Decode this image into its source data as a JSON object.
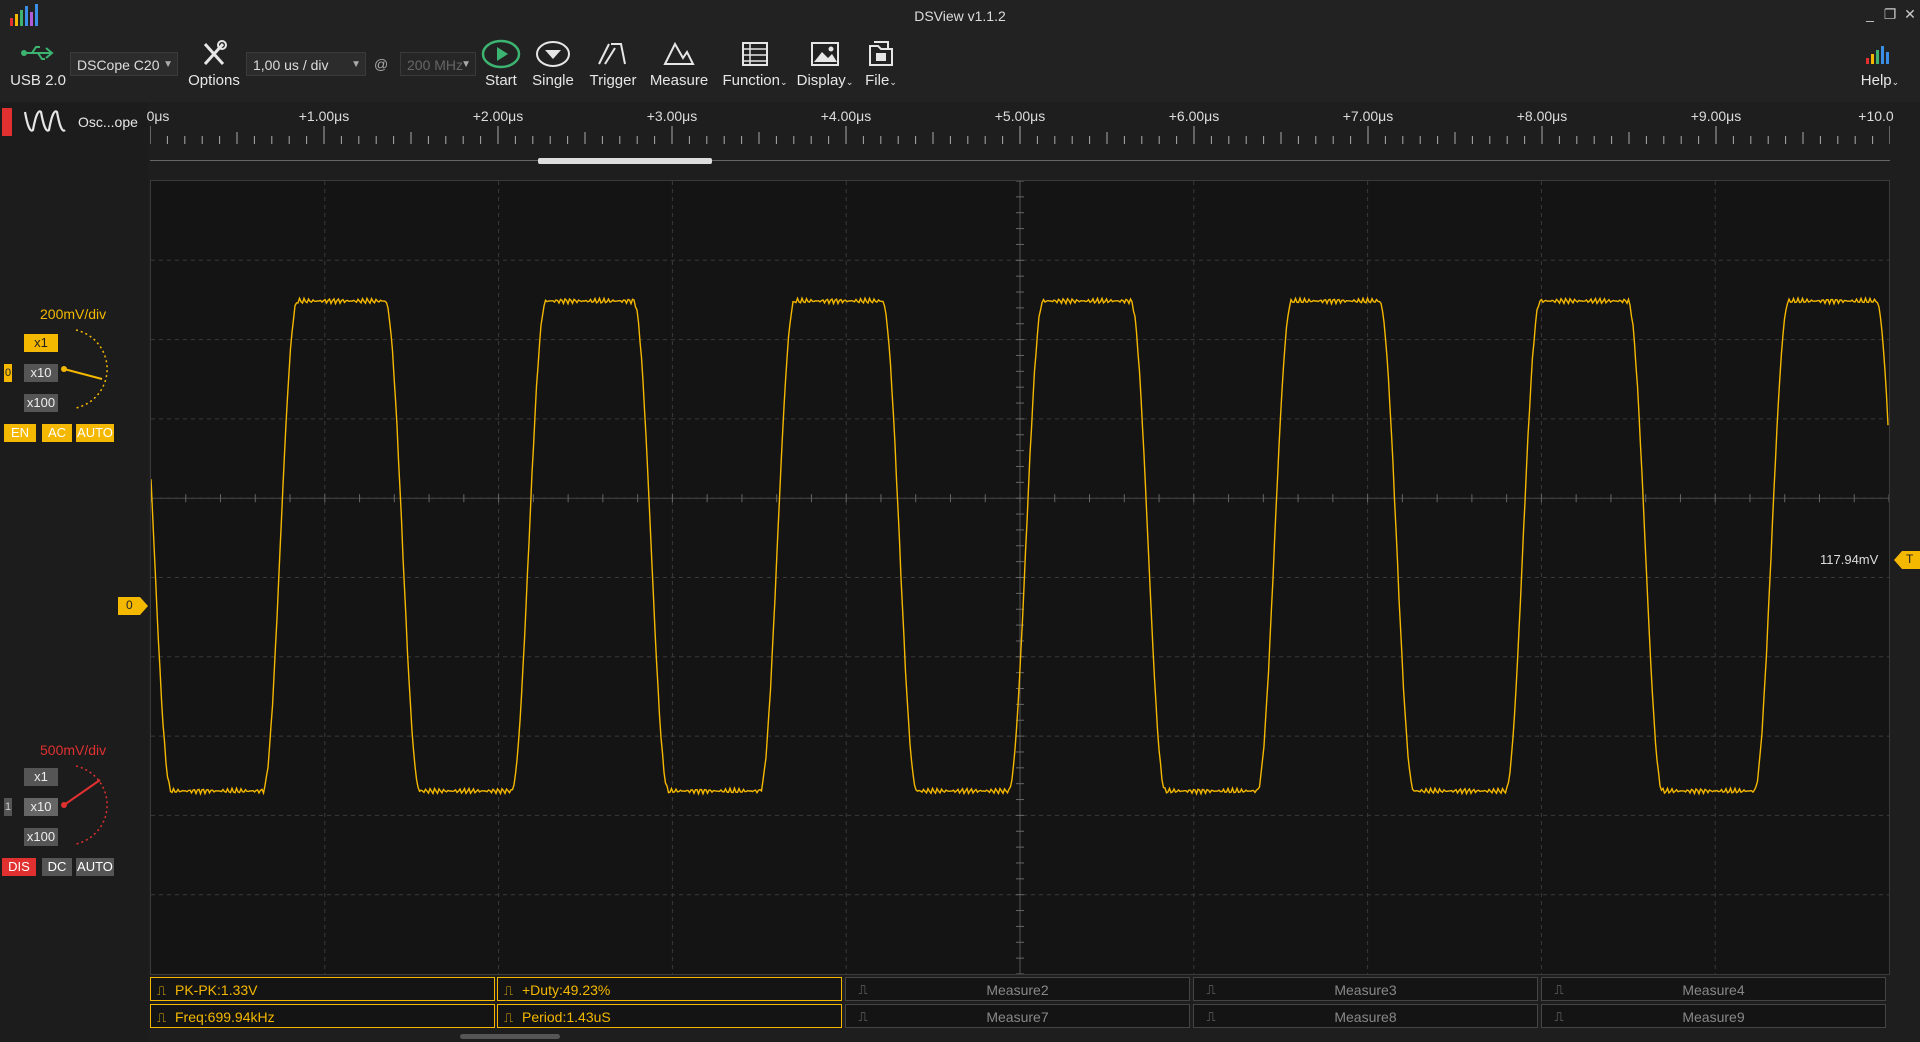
{
  "window": {
    "title": "DSView v1.1.2",
    "buttons": {
      "minimize": "_",
      "restore": "❐",
      "close": "✕"
    }
  },
  "toolbar": {
    "usb_label": "USB 2.0",
    "device": "DSCope C20",
    "options_label": "Options",
    "timebase": "1,00 us / div",
    "at_symbol": "@",
    "samplerate": "200 MHz",
    "start_label": "Start",
    "single_label": "Single",
    "trigger_label": "Trigger",
    "measure_label": "Measure",
    "function_label": "Function",
    "display_label": "Display",
    "file_label": "File",
    "help_label": "Help"
  },
  "mode": {
    "label": "Osc...ope"
  },
  "ruler": {
    "ticks": [
      "0μs",
      "+1.00μs",
      "+2.00μs",
      "+3.00μs",
      "+4.00μs",
      "+5.00μs",
      "+6.00μs",
      "+7.00μs",
      "+8.00μs",
      "+9.00μs",
      "+10.0"
    ]
  },
  "channels": [
    {
      "index": "0",
      "vdiv": "200mV/div",
      "color": "#f5b800",
      "probes": [
        "x1",
        "x10",
        "x100"
      ],
      "selected_probe": "x1",
      "enable": "EN",
      "coupling": "AC",
      "auto": "AUTO"
    },
    {
      "index": "1",
      "vdiv": "500mV/div",
      "color": "#e03030",
      "probes": [
        "x1",
        "x10",
        "x100"
      ],
      "selected_probe": "x10",
      "enable": "DIS",
      "coupling": "DC",
      "auto": "AUTO"
    }
  ],
  "scope": {
    "trigger_level": "117.94mV",
    "trigger_marker": "T",
    "ch0_zero_marker": "0",
    "waveform": {
      "frequency_khz": 699.94,
      "period_us": 1.43,
      "duty_percent": 49.23,
      "pk_pk_v": 1.33,
      "trace_color": "#f5b800"
    }
  },
  "measurements": {
    "row1": [
      {
        "label": "PK-PK:1.33V",
        "active": true
      },
      {
        "label": "+Duty:49.23%",
        "active": true
      },
      {
        "label": "Measure2",
        "active": false
      },
      {
        "label": "Measure3",
        "active": false
      },
      {
        "label": "Measure4",
        "active": false
      }
    ],
    "row2": [
      {
        "label": "Freq:699.94kHz",
        "active": true
      },
      {
        "label": "Period:1.43uS",
        "active": true
      },
      {
        "label": "Measure7",
        "active": false
      },
      {
        "label": "Measure8",
        "active": false
      },
      {
        "label": "Measure9",
        "active": false
      }
    ]
  }
}
